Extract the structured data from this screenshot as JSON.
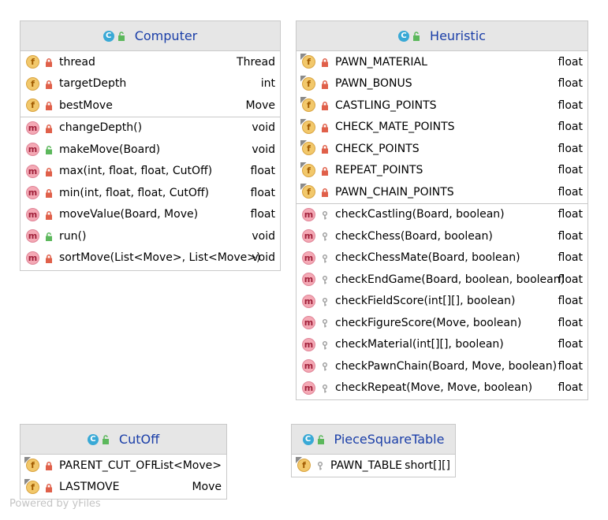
{
  "classes": {
    "computer": {
      "name": "Computer",
      "fields": [
        {
          "name": "thread",
          "type": "Thread",
          "vis": "private",
          "static": false
        },
        {
          "name": "targetDepth",
          "type": "int",
          "vis": "private",
          "static": false
        },
        {
          "name": "bestMove",
          "type": "Move",
          "vis": "private",
          "static": false
        }
      ],
      "methods": [
        {
          "name": "changeDepth()",
          "type": "void",
          "vis": "private"
        },
        {
          "name": "makeMove(Board)",
          "type": "void",
          "vis": "public"
        },
        {
          "name": "max(int, float, float, CutOff)",
          "type": "float",
          "vis": "private"
        },
        {
          "name": "min(int, float, float, CutOff)",
          "type": "float",
          "vis": "private"
        },
        {
          "name": "moveValue(Board, Move)",
          "type": "float",
          "vis": "private"
        },
        {
          "name": "run()",
          "type": "void",
          "vis": "public"
        },
        {
          "name": "sortMove(List<Move>, List<Move>)",
          "type": "void",
          "vis": "private"
        }
      ]
    },
    "heuristic": {
      "name": "Heuristic",
      "fields": [
        {
          "name": "PAWN_MATERIAL",
          "type": "float",
          "vis": "private",
          "static": true
        },
        {
          "name": "PAWN_BONUS",
          "type": "float",
          "vis": "private",
          "static": true
        },
        {
          "name": "CASTLING_POINTS",
          "type": "float",
          "vis": "private",
          "static": true
        },
        {
          "name": "CHECK_MATE_POINTS",
          "type": "float",
          "vis": "private",
          "static": true
        },
        {
          "name": "CHECK_POINTS",
          "type": "float",
          "vis": "private",
          "static": true
        },
        {
          "name": "REPEAT_POINTS",
          "type": "float",
          "vis": "private",
          "static": true
        },
        {
          "name": "PAWN_CHAIN_POINTS",
          "type": "float",
          "vis": "private",
          "static": true
        }
      ],
      "methods": [
        {
          "name": "checkCastling(Board, boolean)",
          "type": "float",
          "vis": "package"
        },
        {
          "name": "checkChess(Board, boolean)",
          "type": "float",
          "vis": "package"
        },
        {
          "name": "checkChessMate(Board, boolean)",
          "type": "float",
          "vis": "package"
        },
        {
          "name": "checkEndGame(Board, boolean, boolean)",
          "type": "float",
          "vis": "package"
        },
        {
          "name": "checkFieldScore(int[][], boolean)",
          "type": "float",
          "vis": "package"
        },
        {
          "name": "checkFigureScore(Move, boolean)",
          "type": "float",
          "vis": "package"
        },
        {
          "name": "checkMaterial(int[][], boolean)",
          "type": "float",
          "vis": "package"
        },
        {
          "name": "checkPawnChain(Board, Move, boolean)",
          "type": "float",
          "vis": "package"
        },
        {
          "name": "checkRepeat(Move, Move, boolean)",
          "type": "float",
          "vis": "package"
        }
      ]
    },
    "cutoff": {
      "name": "CutOff",
      "fields": [
        {
          "name": "PARENT_CUT_OFF",
          "type": "List<Move>",
          "vis": "private",
          "static": true
        },
        {
          "name": "LASTMOVE",
          "type": "Move",
          "vis": "private",
          "static": true
        }
      ],
      "methods": []
    },
    "piecesquaretable": {
      "name": "PieceSquareTable",
      "fields": [
        {
          "name": "PAWN_TABLE",
          "type": "short[][]",
          "vis": "package",
          "static": true
        }
      ],
      "methods": []
    }
  },
  "colors": {
    "title": "#1a3ea8",
    "header_bg": "#e6e6e6",
    "private_lock": "#e0604a",
    "public_lock": "#5cb85c",
    "package_key": "#9a9a9a"
  },
  "watermark": "Powered by yFiles"
}
